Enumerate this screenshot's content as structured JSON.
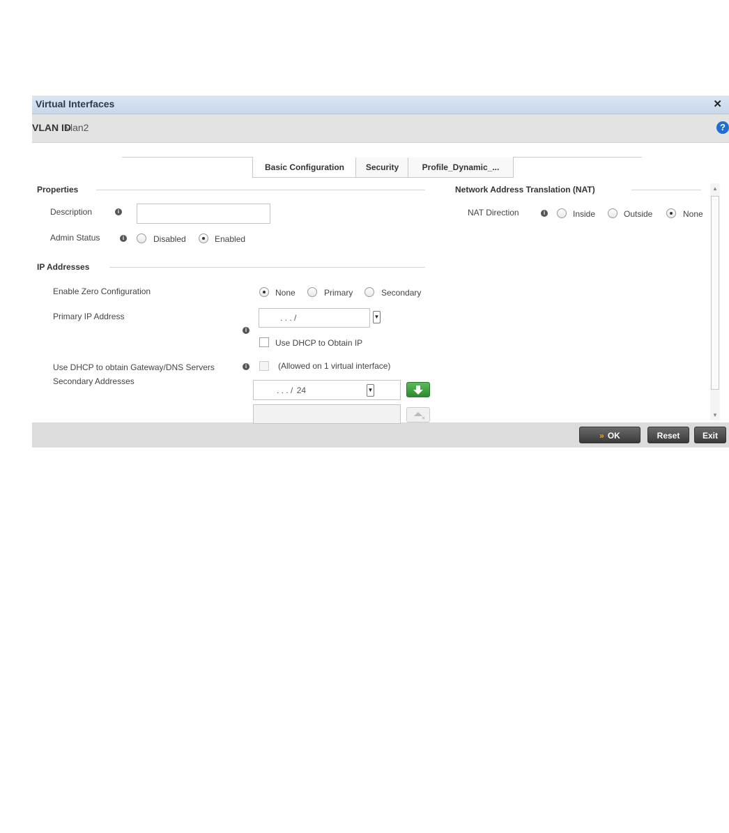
{
  "window": {
    "title": "Virtual Interfaces"
  },
  "vlan": {
    "label": "VLAN ID",
    "value": "vlan2"
  },
  "tabs": [
    {
      "label": "Basic Configuration",
      "active": true
    },
    {
      "label": "Security",
      "active": false
    },
    {
      "label": "Profile_Dynamic_...",
      "active": false
    }
  ],
  "properties": {
    "heading": "Properties",
    "description_label": "Description",
    "description_value": "",
    "admin_status_label": "Admin Status",
    "admin_status_options": [
      "Disabled",
      "Enabled"
    ],
    "admin_status_selected": "Enabled"
  },
  "ip_addresses": {
    "heading": "IP Addresses",
    "zero_config_label": "Enable Zero Configuration",
    "zero_config_options": [
      "None",
      "Primary",
      "Secondary"
    ],
    "zero_config_selected": "None",
    "primary_ip_label": "Primary IP Address",
    "primary_ip_mask": ".     .     .     /",
    "use_dhcp_label": "Use DHCP to Obtain IP",
    "dhcp_gateway_label": "Use DHCP to obtain Gateway/DNS Servers",
    "dhcp_gateway_note": "(Allowed on 1 virtual interface)",
    "secondary_label": "Secondary Addresses",
    "secondary_mask": ".     .     .     /",
    "secondary_prefix": "24"
  },
  "nat": {
    "heading": "Network Address Translation (NAT)",
    "direction_label": "NAT Direction",
    "options": [
      "Inside",
      "Outside",
      "None"
    ],
    "selected": "None"
  },
  "footer": {
    "ok_label": "OK",
    "reset_label": "Reset",
    "exit_label": "Exit"
  },
  "icons": {
    "close": "close-icon",
    "help": "help-icon",
    "info": "info-icon",
    "add": "down-arrow-add-icon",
    "remove": "remove-entry-icon"
  },
  "colors": {
    "title_bar": "#c7d7ea",
    "help": "#1e6fd0",
    "add_button": "#3a9a3a",
    "ok_chevron": "#f2a21a"
  }
}
